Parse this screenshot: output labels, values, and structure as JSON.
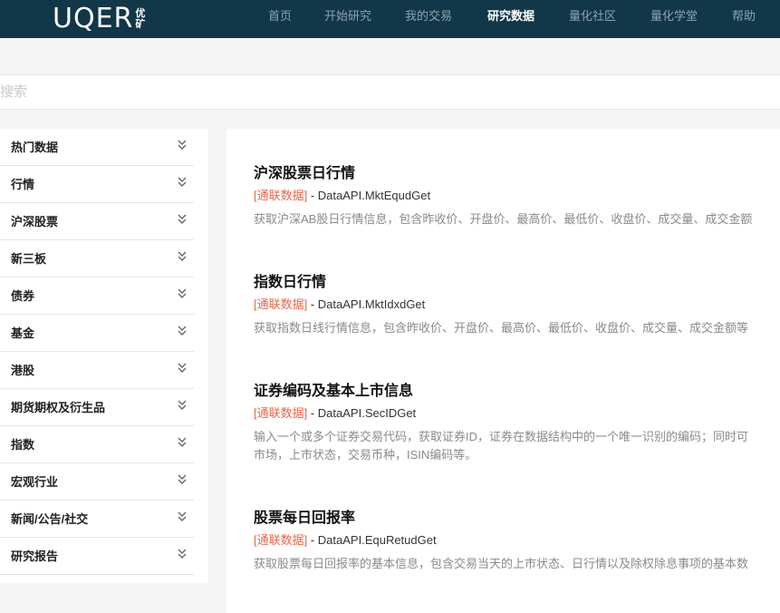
{
  "logo": {
    "text": "UQER",
    "cn_top": "优",
    "cn_bottom": "矿"
  },
  "nav": [
    "首页",
    "开始研究",
    "我的交易",
    "研究数据",
    "量化社区",
    "量化学堂",
    "帮助"
  ],
  "nav_active": "研究数据",
  "search": {
    "placeholder": "搜索",
    "value": ""
  },
  "sidebar": {
    "items": [
      "热门数据",
      "行情",
      "沪深股票",
      "新三板",
      "债券",
      "基金",
      "港股",
      "期货期权及衍生品",
      "指数",
      "宏观行业",
      "新闻/公告/社交",
      "研究报告"
    ]
  },
  "entries": [
    {
      "title": "沪深股票日行情",
      "tag": "[通联数据]",
      "api": " - DataAPI.MktEqudGet",
      "desc": "获取沪深AB股日行情信息，包含昨收价、开盘价、最高价、最低价、收盘价、成交量、成交金额"
    },
    {
      "title": "指数日行情",
      "tag": "[通联数据]",
      "api": " - DataAPI.MktIdxdGet",
      "desc": "获取指数日线行情信息，包含昨收价、开盘价、最高价、最低价、收盘价、成交量、成交金额等"
    },
    {
      "title": "证券编码及基本上市信息",
      "tag": "[通联数据]",
      "api": " - DataAPI.SecIDGet",
      "desc": "输入一个或多个证券交易代码，获取证券ID，证券在数据结构中的一个唯一识别的编码；同时可",
      "desc2": "市场，上市状态，交易币种，ISIN编码等。"
    },
    {
      "title": "股票每日回报率",
      "tag": "[通联数据]",
      "api": " - DataAPI.EquRetudGet",
      "desc": "获取股票每日回报率的基本信息，包含交易当天的上市状态、日行情以及除权除息事项的基本数"
    }
  ],
  "colors": {
    "topbar": "#113748",
    "tag": "#e8674a"
  }
}
